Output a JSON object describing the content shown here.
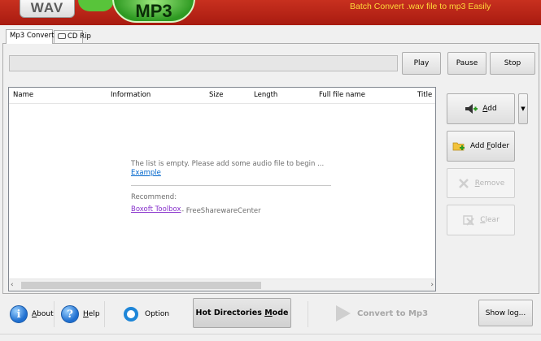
{
  "banner": {
    "left_badge": "WAV",
    "right_badge": "MP3",
    "tagline": "Batch Convert .wav file to mp3 Easily"
  },
  "tabs": [
    {
      "label": "Mp3 Convert",
      "active": true
    },
    {
      "label": "CD Rip",
      "active": false
    }
  ],
  "player": {
    "progress_percent": 0,
    "play_label": "Play",
    "pause_label": "Pause",
    "stop_label": "Stop"
  },
  "file_list": {
    "columns": [
      "Name",
      "Information",
      "Size",
      "Length",
      "Full file name",
      "Title"
    ],
    "empty_message": "The list is empty. Please add some audio file to begin ...",
    "example_link": "Example",
    "recommend_label": "Recommend:",
    "boxoft_link": "Boxoft Toolbox",
    "fsc_label": "- FreeSharewareCenter"
  },
  "side_buttons": {
    "add": {
      "underline": "A",
      "rest": "dd"
    },
    "add_folder": {
      "pre": "Add ",
      "underline": "F",
      "rest": "older"
    },
    "remove": {
      "underline": "R",
      "rest": "emove"
    },
    "clear": {
      "underline": "C",
      "rest": "lear"
    }
  },
  "toolbar": {
    "about_pre": "",
    "about_underline": "A",
    "about_rest": "bout",
    "help_underline": "H",
    "help_rest": "elp",
    "option_label": "Option",
    "hot_dir_pre": "Hot Directories ",
    "hot_dir_underline": "M",
    "hot_dir_rest": "ode",
    "convert_label": "Convert to Mp3",
    "show_log_label": "Show log..."
  },
  "colors": {
    "banner": "#b52415",
    "tagline": "#ffd83a",
    "progress": "#06b025",
    "link": "#0066cc",
    "link_visited": "#8833cc"
  }
}
